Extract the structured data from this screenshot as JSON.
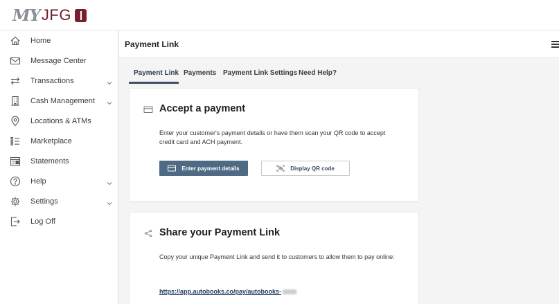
{
  "header": {
    "logo_my": "MY",
    "logo_brand": "JFG"
  },
  "sidebar": {
    "items": [
      {
        "label": "Home",
        "icon": "home-icon",
        "expandable": false
      },
      {
        "label": "Message Center",
        "icon": "envelope-icon",
        "expandable": false
      },
      {
        "label": "Transactions",
        "icon": "transfer-arrows-icon",
        "expandable": true
      },
      {
        "label": "Cash Management",
        "icon": "building-icon",
        "expandable": true
      },
      {
        "label": "Locations & ATMs",
        "icon": "map-pin-icon",
        "expandable": false
      },
      {
        "label": "Marketplace",
        "icon": "list-icon",
        "expandable": false
      },
      {
        "label": "Statements",
        "icon": "statement-icon",
        "expandable": false
      },
      {
        "label": "Help",
        "icon": "question-icon",
        "expandable": true
      },
      {
        "label": "Settings",
        "icon": "gear-icon",
        "expandable": true
      },
      {
        "label": "Log Off",
        "icon": "logout-icon",
        "expandable": false
      }
    ]
  },
  "main": {
    "title": "Payment Link",
    "tabs": [
      {
        "label": "Payment Link",
        "active": true
      },
      {
        "label": "Payments",
        "active": false
      },
      {
        "label": "Payment Link Settings",
        "active": false
      },
      {
        "label": "Need Help?",
        "active": false
      }
    ],
    "accept_card": {
      "title": "Accept a payment",
      "description": "Enter your customer's payment details or have them scan your QR code to accept credit card and ACH payment.",
      "primary_button": "Enter payment details",
      "secondary_button": "Display QR code"
    },
    "share_card": {
      "title": "Share your Payment Link",
      "description": "Copy your unique Payment Link and send it to customers to allow them to pay online:",
      "link": "https://app.autobooks.co/pay/autobooks-"
    }
  },
  "colors": {
    "brand": "#7a1d31",
    "primary_button": "#4e6a84",
    "tab_underline": "#3c4f66",
    "link": "#1f3a5f"
  }
}
